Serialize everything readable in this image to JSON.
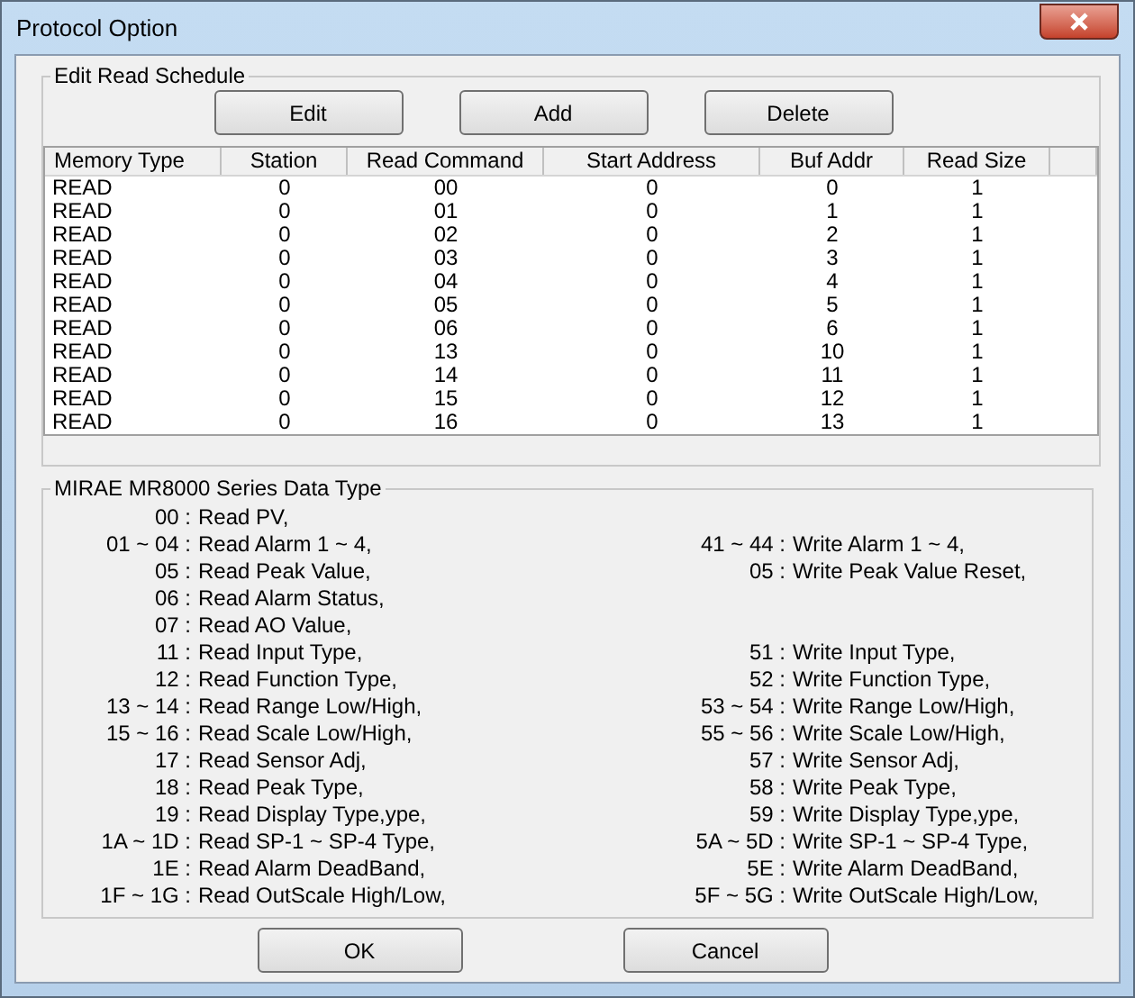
{
  "window": {
    "title": "Protocol Option"
  },
  "schedule": {
    "title": "Edit Read Schedule",
    "buttons": [
      "Edit",
      "Add",
      "Delete"
    ],
    "columns": [
      "Memory Type",
      "Station",
      "Read Command",
      "Start Address",
      "Buf Addr",
      "Read Size"
    ],
    "rows": [
      [
        "READ",
        "0",
        "00",
        "0",
        "0",
        "1"
      ],
      [
        "READ",
        "0",
        "01",
        "0",
        "1",
        "1"
      ],
      [
        "READ",
        "0",
        "02",
        "0",
        "2",
        "1"
      ],
      [
        "READ",
        "0",
        "03",
        "0",
        "3",
        "1"
      ],
      [
        "READ",
        "0",
        "04",
        "0",
        "4",
        "1"
      ],
      [
        "READ",
        "0",
        "05",
        "0",
        "5",
        "1"
      ],
      [
        "READ",
        "0",
        "06",
        "0",
        "6",
        "1"
      ],
      [
        "READ",
        "0",
        "13",
        "0",
        "10",
        "1"
      ],
      [
        "READ",
        "0",
        "14",
        "0",
        "11",
        "1"
      ],
      [
        "READ",
        "0",
        "15",
        "0",
        "12",
        "1"
      ],
      [
        "READ",
        "0",
        "16",
        "0",
        "13",
        "1"
      ]
    ]
  },
  "data_type": {
    "title": "MIRAE MR8000 Series Data Type",
    "lines": [
      {
        "read": {
          "code": "00 :",
          "text": "Read PV,"
        }
      },
      {
        "read": {
          "code": "01 ~ 04 :",
          "text": "Read Alarm 1 ~ 4,"
        },
        "write": {
          "code": "41 ~ 44 :",
          "text": "Write Alarm 1 ~ 4,"
        }
      },
      {
        "read": {
          "code": "05 :",
          "text": "Read Peak Value,"
        },
        "write": {
          "code": "05 :",
          "text": "Write Peak Value Reset,"
        }
      },
      {
        "read": {
          "code": "06 :",
          "text": "Read Alarm Status,"
        }
      },
      {
        "read": {
          "code": "07 :",
          "text": "Read AO Value,"
        }
      },
      {
        "read": {
          "code": "11 :",
          "text": "Read Input Type,"
        },
        "write": {
          "code": "51 :",
          "text": "Write Input Type,"
        }
      },
      {
        "read": {
          "code": "12 :",
          "text": "Read Function Type,"
        },
        "write": {
          "code": "52 :",
          "text": "Write Function Type,"
        }
      },
      {
        "read": {
          "code": "13 ~ 14 :",
          "text": "Read Range Low/High,"
        },
        "write": {
          "code": "53 ~ 54 :",
          "text": "Write Range Low/High,"
        }
      },
      {
        "read": {
          "code": "15 ~ 16 :",
          "text": "Read Scale Low/High,"
        },
        "write": {
          "code": "55 ~ 56 :",
          "text": "Write Scale Low/High,"
        }
      },
      {
        "read": {
          "code": "17 :",
          "text": "Read Sensor Adj,"
        },
        "write": {
          "code": "57 :",
          "text": "Write Sensor Adj,"
        }
      },
      {
        "read": {
          "code": "18 :",
          "text": "Read Peak Type,"
        },
        "write": {
          "code": "58 :",
          "text": "Write Peak Type,"
        }
      },
      {
        "read": {
          "code": "19 :",
          "text": "Read Display Type,ype,"
        },
        "write": {
          "code": "59 :",
          "text": "Write Display Type,ype,"
        }
      },
      {
        "read": {
          "code": "1A ~ 1D :",
          "text": "Read SP-1 ~ SP-4 Type,"
        },
        "write": {
          "code": "5A ~ 5D :",
          "text": "Write SP-1 ~ SP-4 Type,"
        }
      },
      {
        "read": {
          "code": "1E :",
          "text": "Read Alarm DeadBand,"
        },
        "write": {
          "code": "5E :",
          "text": "Write Alarm DeadBand,"
        }
      },
      {
        "read": {
          "code": "1F ~ 1G :",
          "text": "Read OutScale High/Low,"
        },
        "write": {
          "code": "5F ~ 5G :",
          "text": "Write OutScale High/Low,"
        }
      }
    ]
  },
  "footer_buttons": [
    "OK",
    "Cancel"
  ]
}
